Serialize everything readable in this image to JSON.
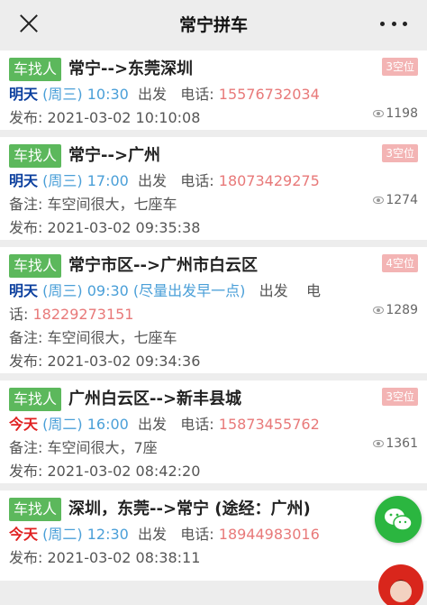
{
  "topbar": {
    "title": "常宁拼车"
  },
  "posts": [
    {
      "tag": "车找人",
      "route": "常宁-->东莞深圳",
      "seats": "3空位",
      "day": "明天",
      "weekday": "(周三)",
      "time": "10:30",
      "depart": "出发",
      "phone_label": "电话:",
      "phone": "15576732034",
      "note": "",
      "published": "发布:  2021-03-02 10:10:08",
      "views": "1198",
      "today": false
    },
    {
      "tag": "车找人",
      "route": "常宁-->广州",
      "seats": "3空位",
      "day": "明天",
      "weekday": "(周三)",
      "time": "17:00",
      "depart": "出发",
      "phone_label": "电话:",
      "phone": "18073429275",
      "note": "备注:  车空间很大，七座车",
      "published": "发布:  2021-03-02 09:35:38",
      "views": "1274",
      "today": false
    },
    {
      "tag": "车找人",
      "route": "常宁市区-->广州市白云区",
      "seats": "4空位",
      "day": "明天",
      "weekday": "(周三)",
      "time": "09:30 (尽量出发早一点)",
      "depart": "出发",
      "phone_label": "电",
      "phone_label2": "话:",
      "phone": "18229273151",
      "note": "备注:  车空间很大，七座车",
      "published": "发布:  2021-03-02 09:34:36",
      "views": "1289",
      "today": false
    },
    {
      "tag": "车找人",
      "route": "广州白云区-->新丰县城",
      "seats": "3空位",
      "day": "今天",
      "weekday": "(周二)",
      "time": "16:00",
      "depart": "出发",
      "phone_label": "电话:",
      "phone": "15873455762",
      "note": "备注:  车空间很大，7座",
      "published": "发布:  2021-03-02 08:42:20",
      "views": "1361",
      "today": true
    },
    {
      "tag": "车找人",
      "route": "深圳，东莞-->常宁 (途经：广州)",
      "seats": "",
      "day": "今天",
      "weekday": "(周二)",
      "time": "12:30",
      "depart": "出发",
      "phone_label": "电话:",
      "phone": "18944983016",
      "note": "",
      "published": "发布:  2021-03-02 08:38:11",
      "views": "",
      "today": true
    }
  ]
}
